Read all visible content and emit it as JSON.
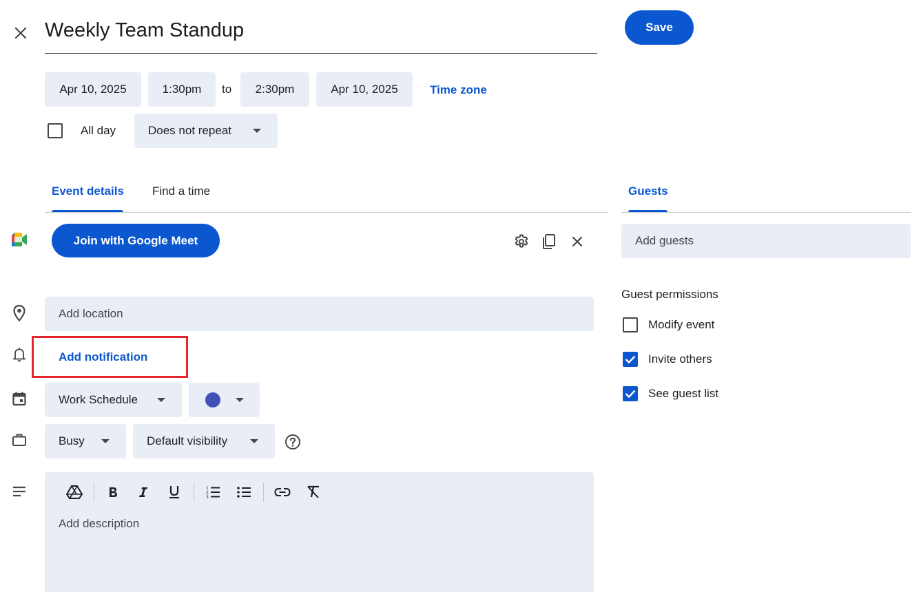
{
  "header": {
    "title": "Weekly Team Standup",
    "save_label": "Save"
  },
  "datetime": {
    "start_date": "Apr 10, 2025",
    "start_time": "1:30pm",
    "to_label": "to",
    "end_time": "2:30pm",
    "end_date": "Apr 10, 2025",
    "time_zone_label": "Time zone",
    "all_day_label": "All day",
    "all_day_checked": false,
    "repeat_value": "Does not repeat"
  },
  "tabs": [
    {
      "label": "Event details",
      "active": true
    },
    {
      "label": "Find a time",
      "active": false
    }
  ],
  "meet": {
    "join_label": "Join with Google Meet"
  },
  "location": {
    "placeholder": "Add location"
  },
  "notification": {
    "label": "Add notification"
  },
  "calendar": {
    "value": "Work Schedule",
    "color": "#3f51b5"
  },
  "availability": {
    "value": "Busy",
    "visibility_value": "Default visibility"
  },
  "description": {
    "placeholder": "Add description"
  },
  "guests": {
    "tab_label": "Guests",
    "input_placeholder": "Add guests",
    "permissions_title": "Guest permissions",
    "permissions": [
      {
        "label": "Modify event",
        "checked": false
      },
      {
        "label": "Invite others",
        "checked": true
      },
      {
        "label": "See guest list",
        "checked": true
      }
    ]
  },
  "colors": {
    "accent": "#0b57d0",
    "chip_bg": "#e9edf6",
    "highlight_box": "#e3262b"
  }
}
